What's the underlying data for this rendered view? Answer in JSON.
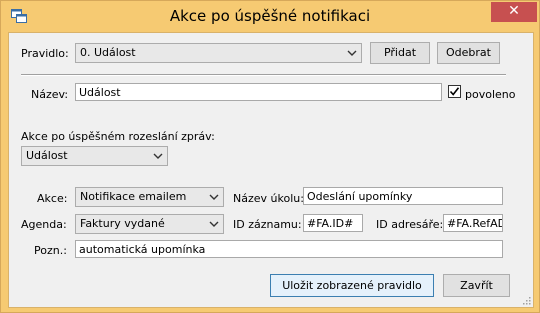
{
  "window": {
    "title": "Akce po úspěšné notifikaci",
    "close_glyph": "✕"
  },
  "rule": {
    "label": "Pravidlo:",
    "selected": "0. Událost",
    "add_button": "Přidat",
    "remove_button": "Odebrat"
  },
  "name": {
    "label": "Název:",
    "value": "Událost",
    "enabled_label": "povoleno",
    "enabled_checked": true
  },
  "action_after": {
    "label": "Akce po úspěšném rozeslání zpráv:",
    "selected": "Událost"
  },
  "action": {
    "label": "Akce:",
    "selected": "Notifikace emailem"
  },
  "task_name": {
    "label": "Název úkolu:",
    "value": "Odeslání upomínky"
  },
  "agenda": {
    "label": "Agenda:",
    "selected": "Faktury vydané"
  },
  "record_id": {
    "label": "ID záznamu:",
    "value": "#FA.ID#"
  },
  "address_id": {
    "label": "ID adresáře:",
    "value": "#FA.RefAD"
  },
  "note": {
    "label": "Pozn.:",
    "value": "automatická upomínka"
  },
  "footer": {
    "save_button": "Uložit zobrazené pravidlo",
    "close_button": "Zavřít"
  },
  "icons": {
    "app": "app-window-icon",
    "dropdown": "chevron-down-icon",
    "check": "check-icon",
    "grip": "resize-grip-icon"
  },
  "colors": {
    "title_bar": "#f6ca72",
    "close_button": "#c75050",
    "client_bg": "#f0f0f0",
    "primary_border": "#3c7fb1"
  }
}
